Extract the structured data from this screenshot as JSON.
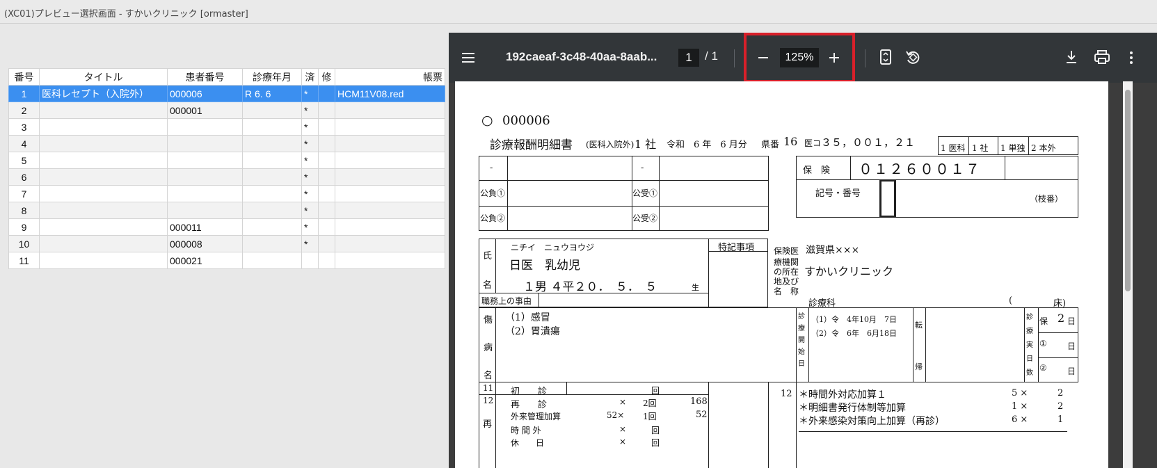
{
  "window": {
    "title": "(XC01)プレビュー選択画面 - すかいクリニック [ormaster]"
  },
  "table": {
    "headers": [
      "番号",
      "タイトル",
      "患者番号",
      "診療年月",
      "済",
      "修",
      "帳票"
    ],
    "rows": [
      [
        "1",
        "医科レセプト（入院外）",
        "000006",
        "R 6. 6",
        "*",
        "",
        "HCM11V08.red"
      ],
      [
        "2",
        "",
        "000001",
        "",
        "*",
        "",
        ""
      ],
      [
        "3",
        "",
        "",
        "",
        "*",
        "",
        ""
      ],
      [
        "4",
        "",
        "",
        "",
        "*",
        "",
        ""
      ],
      [
        "5",
        "",
        "",
        "",
        "*",
        "",
        ""
      ],
      [
        "6",
        "",
        "",
        "",
        "*",
        "",
        ""
      ],
      [
        "7",
        "",
        "",
        "",
        "*",
        "",
        ""
      ],
      [
        "8",
        "",
        "",
        "",
        "*",
        "",
        ""
      ],
      [
        "9",
        "",
        "000011",
        "",
        "*",
        "",
        ""
      ],
      [
        "10",
        "",
        "000008",
        "",
        "*",
        "",
        ""
      ],
      [
        "11",
        "",
        "000021",
        "",
        "",
        "",
        ""
      ]
    ]
  },
  "viewer": {
    "menu_icon": "hamburger-icon",
    "filename": "192caeaf-3c48-40aa-8aab...",
    "page_current": "1",
    "page_total": "/  1",
    "zoom": "125%",
    "accent_highlight": "#d9202a"
  },
  "doc": {
    "circle": "○",
    "patient_no": "000006",
    "title_main": "診療報酬明細書",
    "title_sub": "(医科入院外)",
    "title_tail": "1 社",
    "reiwa": "令和　6 年　6 月分",
    "kenban_label": "県番",
    "kenban": "16",
    "ikoto_label": "医コ",
    "ikoto": "３５，００１，２１",
    "cat1": "1 医科",
    "cat2": "1 社",
    "cat3": "1 単独",
    "cat4": "2 本外",
    "dash1": "-",
    "dash2": "-",
    "kofu1": "公負①",
    "kofu2": "公負②",
    "koju1": "公受①",
    "koju2": "公受②",
    "hoken_label": "保　険",
    "hoken_no": "０１２６００１７",
    "kigo_label": "記号・番号",
    "edaban": "（枝番）",
    "shi": "氏",
    "mei": "名",
    "kana": "ニチイ　ニュウヨウジ",
    "name": "日医　乳幼児",
    "sex_birth": "１男 ４平２０．　５．　５",
    "sei": "生",
    "tokki": "特記事項",
    "shokumu": "職務上の事由",
    "iryokikan_label_1": "保険医",
    "iryokikan_label_2": "療機関",
    "iryokikan_label_3": "の所在",
    "iryokikan_label_4": "地及び",
    "iryokikan_label_5": "名　称",
    "address": "滋賀県×××",
    "clinic": "すかいクリニック",
    "shinryoka": "診療科",
    "paren": "(",
    "yuka": "床)",
    "sho": "傷",
    "byo": "病",
    "mei2": "名",
    "dx1": "（1）感冒",
    "dx2": "（2）胃潰瘍",
    "kaishi_v": "診療開始日",
    "start1": "（1）令　4年10月　7日",
    "start2": "（2）令　6年　6月18日",
    "ten": "転",
    "ki": "帰",
    "jitsu_v": "診療実日数",
    "ho": "保",
    "ho_days": "2",
    "nichi": "日",
    "k1": "①",
    "k2": "②",
    "r11": "11",
    "shoshin": "初　　診",
    "kai": "回",
    "r12": "12",
    "sai": "再",
    "saishin": "再　　診",
    "saishin_x": "×",
    "saishin_n": "2回",
    "saishin_pt": "168",
    "gairai": "外来管理加算",
    "gairai_x": "52×",
    "gairai_n": "1回",
    "gairai_pt": "52",
    "jikangai": "時 間 外",
    "jikangai_x": "×",
    "jikangai_n": "回",
    "kyujitsu": "休　　日",
    "kyujitsu_x": "×",
    "kyujitsu_n": "回",
    "r12b": "12",
    "item1": "＊時間外対応加算１",
    "item1_q": "5 ×",
    "item1_n": "2",
    "item2": "＊明細書発行体制等加算",
    "item2_q": "1 ×",
    "item2_n": "2",
    "item3": "＊外来感染対策向上加算（再診）",
    "item3_q": "6 ×",
    "item3_n": "1"
  }
}
